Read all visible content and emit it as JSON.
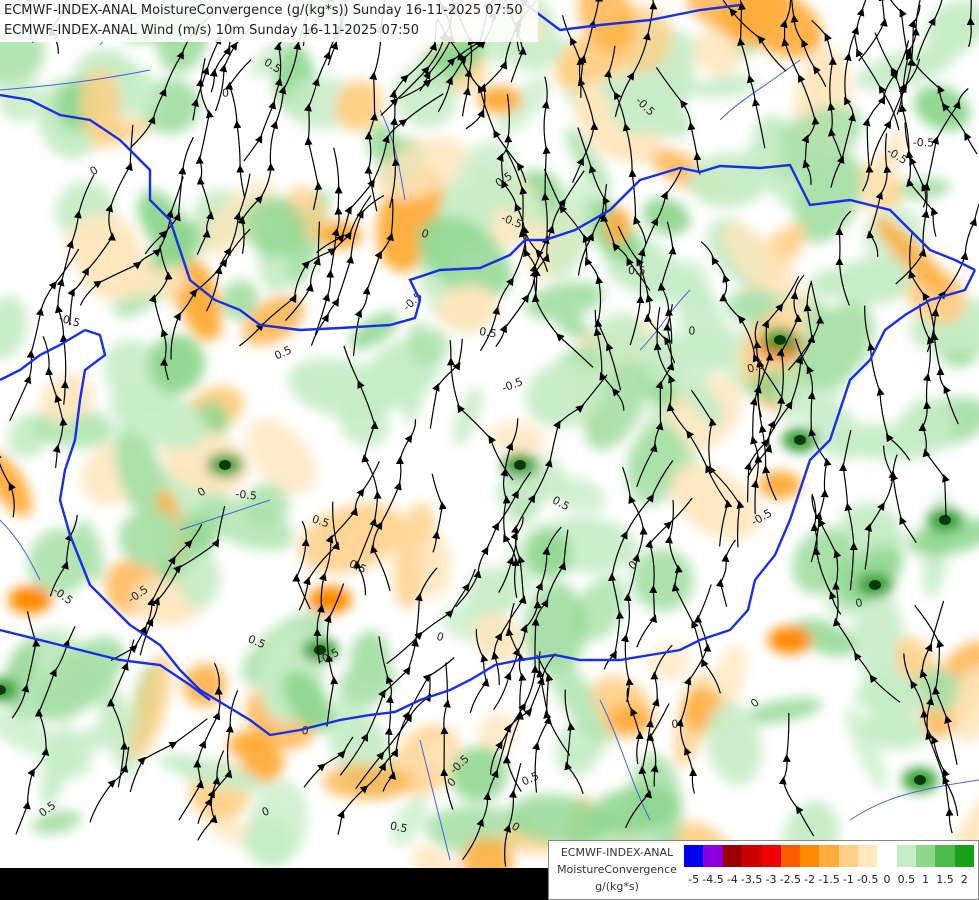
{
  "header": {
    "line1": "ECMWF-INDEX-ANAL MoistureConvergence (g/(kg*s)) Sunday 16-11-2025 07:50",
    "line2": "ECMWF-INDEX-ANAL Wind (m/s) 10m Sunday 16-11-2025 07:50"
  },
  "legend": {
    "model": "ECMWF-INDEX-ANAL",
    "parameter": "MoistureConvergence",
    "unit": "g/(kg*s)",
    "ticks": [
      "-5",
      "-4.5",
      "-4",
      "-3.5",
      "-3",
      "-2.5",
      "-2",
      "-1.5",
      "-1",
      "-0.5",
      "0",
      "0.5",
      "1",
      "1.5",
      "2"
    ],
    "colors": [
      "#0000ee",
      "#8a00e0",
      "#9c0000",
      "#cc0000",
      "#ee0000",
      "#ff5a00",
      "#ff8a00",
      "#ffad3c",
      "#ffcf86",
      "#ffe6bc",
      "#ffffff",
      "#c6ecc6",
      "#8ed68e",
      "#4cbb4c",
      "#18a018"
    ]
  },
  "map": {
    "contour_labels": [
      "0",
      "0.5",
      "-0.5",
      "0",
      "-0.5",
      "0.5",
      "0",
      "-0.5",
      "0.5",
      "0",
      "-0.5",
      "0.5",
      "0",
      "0.5",
      "-0.5",
      "0",
      "0.5",
      "-0.5",
      "0",
      "0.5",
      "0",
      "-0.5",
      "0.5",
      "0",
      "-0.5",
      "0",
      "0.5",
      "-0.5",
      "0",
      "0.5",
      "-0.5",
      "0",
      "-0.5",
      "0.5",
      "0",
      "0.5",
      "-0.5",
      "0",
      "0.5",
      "-0.5"
    ],
    "colors": {
      "border": "#1a2ee8",
      "river": "#4a62e0",
      "streamline": "#000000",
      "contour": "#222222"
    }
  }
}
